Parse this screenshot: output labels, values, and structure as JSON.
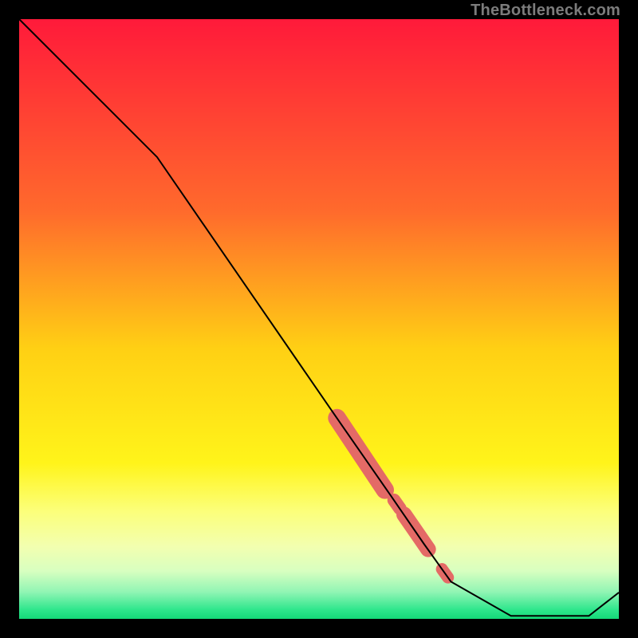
{
  "watermark": "TheBottleneck.com",
  "chart_data": {
    "type": "line",
    "title": "",
    "xlabel": "",
    "ylabel": "",
    "xlim": [
      0,
      100
    ],
    "ylim": [
      0,
      100
    ],
    "grid": false,
    "legend": false,
    "series": [
      {
        "name": "bottleneck-curve",
        "x": [
          0,
          23,
          54,
          62,
          67.5,
          70,
          72,
          82,
          95,
          100
        ],
        "y": [
          100,
          77,
          32,
          20.5,
          12.5,
          9,
          6.2,
          0.5,
          0.5,
          4.4
        ]
      }
    ],
    "markers": [
      {
        "name": "segment-a",
        "x1": 53.0,
        "y1": 33.5,
        "x2": 61.0,
        "y2": 21.5,
        "thickness": 3.0
      },
      {
        "name": "dot-a",
        "x1": 62.5,
        "y1": 19.8,
        "x2": 63.5,
        "y2": 18.4,
        "thickness": 2.2
      },
      {
        "name": "segment-b",
        "x1": 64.2,
        "y1": 17.4,
        "x2": 68.2,
        "y2": 11.6,
        "thickness": 2.6
      },
      {
        "name": "dot-b",
        "x1": 70.5,
        "y1": 8.3,
        "x2": 71.5,
        "y2": 6.9,
        "thickness": 2.0
      }
    ],
    "gradient_stops": [
      {
        "offset": 0,
        "color": "#ff1a3a"
      },
      {
        "offset": 0.32,
        "color": "#ff6a2c"
      },
      {
        "offset": 0.55,
        "color": "#ffd014"
      },
      {
        "offset": 0.74,
        "color": "#fff41a"
      },
      {
        "offset": 0.82,
        "color": "#fcff7a"
      },
      {
        "offset": 0.88,
        "color": "#f2ffb0"
      },
      {
        "offset": 0.92,
        "color": "#d8ffc0"
      },
      {
        "offset": 0.955,
        "color": "#91f5b4"
      },
      {
        "offset": 0.985,
        "color": "#2ee68c"
      },
      {
        "offset": 1.0,
        "color": "#14d978"
      }
    ],
    "marker_color": "#e46a66",
    "line_color": "#000000"
  }
}
